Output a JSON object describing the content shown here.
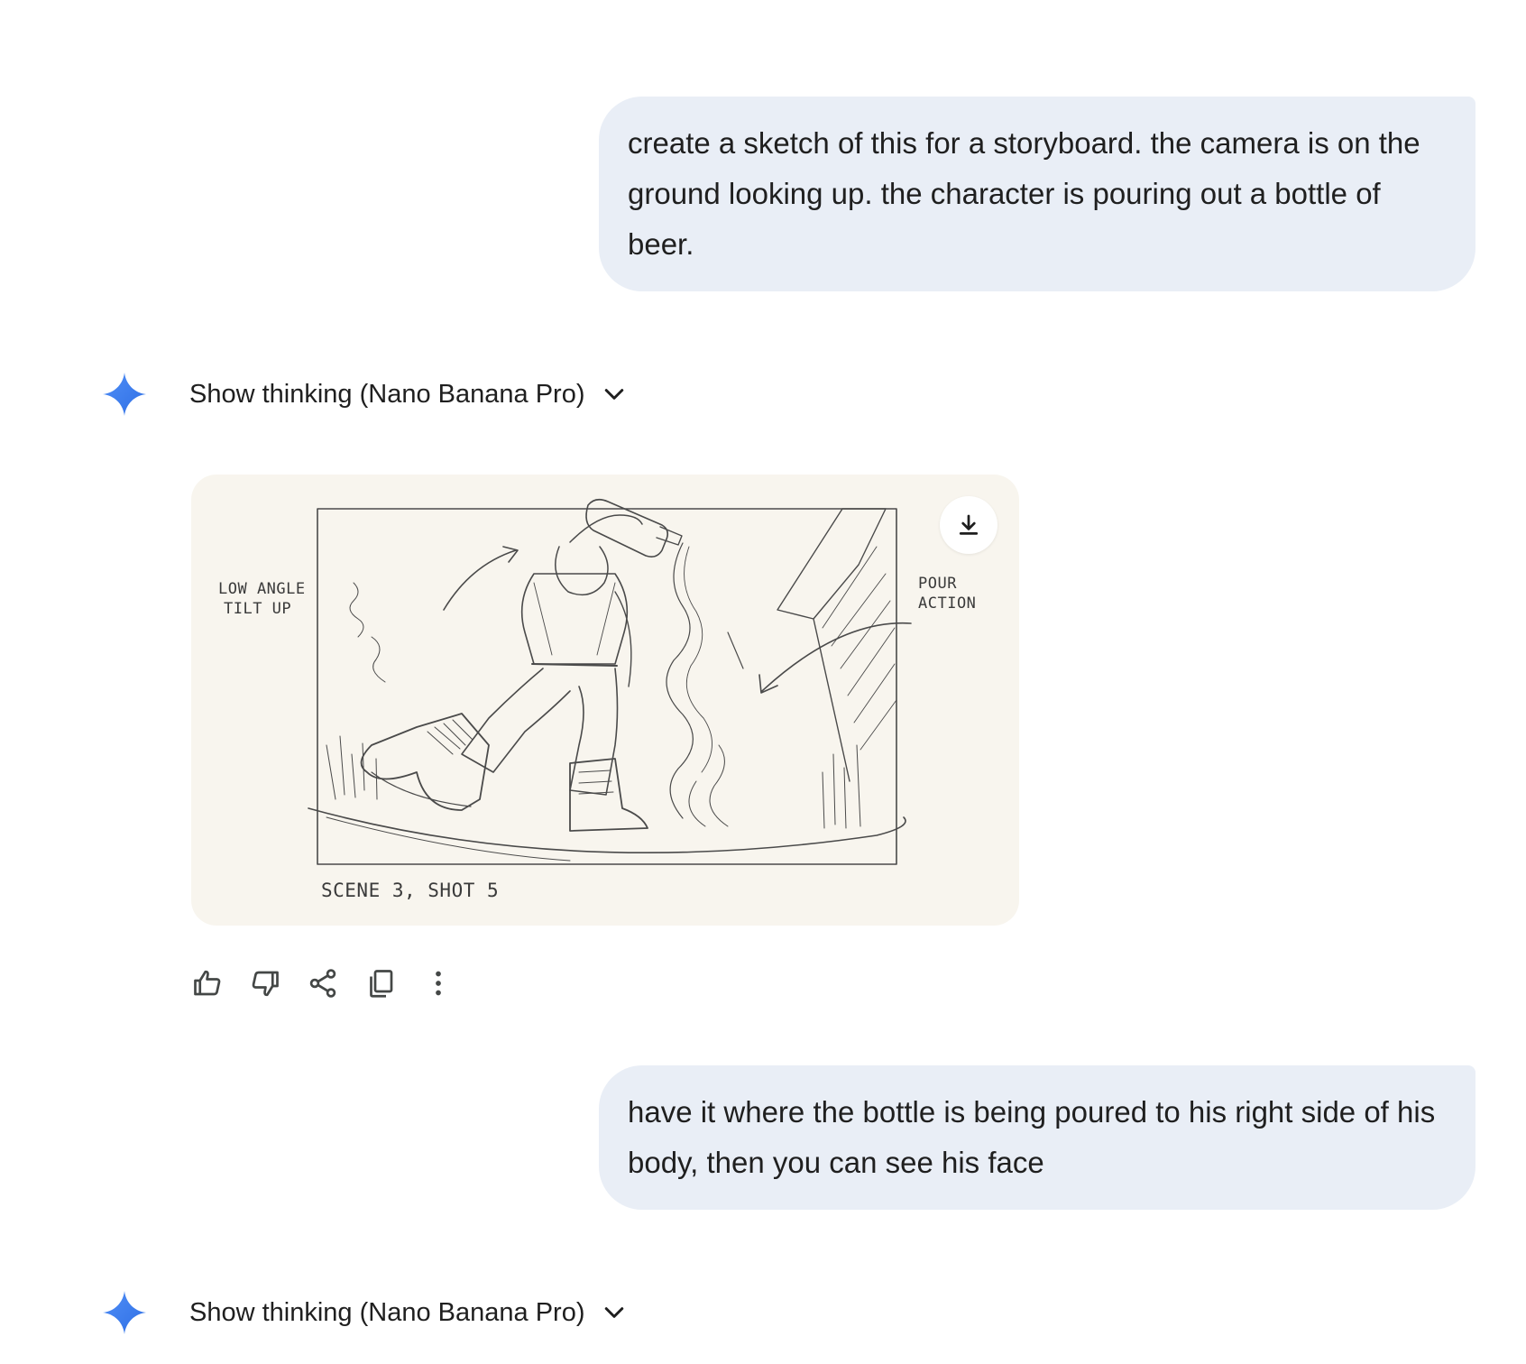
{
  "conversation": {
    "messages": [
      {
        "role": "user",
        "text": "create a sketch of this for a storyboard. the camera is on the ground looking up. the character is pouring out a bottle of beer."
      },
      {
        "role": "model",
        "thinking_label": "Show thinking (Nano Banana Pro)"
      },
      {
        "role": "user",
        "text": "have it where the bottle is being poured to his right side of his body, then you can see his face"
      },
      {
        "role": "model",
        "thinking_label": "Show thinking (Nano Banana Pro)"
      }
    ]
  },
  "image": {
    "annotations": {
      "left_note": [
        "LOW ANGLE",
        "TILT UP"
      ],
      "right_note": [
        "POUR",
        "ACTION"
      ],
      "caption": "SCENE 3, SHOT 5"
    }
  },
  "icons": {
    "assistant": "gemini-sparkle-icon",
    "expand": "chevron-down-icon",
    "download": "download-icon",
    "actions": [
      "thumbs-up-icon",
      "thumbs-down-icon",
      "share-icon",
      "copy-icon",
      "more-vert-icon"
    ]
  },
  "colors": {
    "user_bubble": "#e9eef6",
    "image_bg": "#f8f5ee",
    "sparkle": "#4285f4"
  }
}
